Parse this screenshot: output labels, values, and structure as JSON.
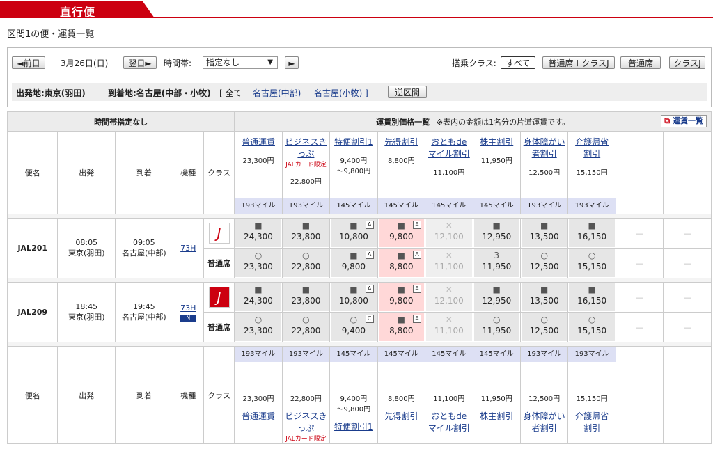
{
  "tab_title": "直行便",
  "route_title": "区間1の便・運賃一覧",
  "nav": {
    "prev": "◄前日",
    "date": "3月26日(日)",
    "next": "翌日►",
    "time_label": "時間帯:",
    "time_value": "指定なし",
    "time_arrow": "▼",
    "go": "►"
  },
  "class_filter": {
    "label": "搭乗クラス:",
    "buttons": [
      "すべて",
      "普通席＋クラスJ",
      "普通席",
      "クラスJ"
    ]
  },
  "route": {
    "dep": "出発地:東京(羽田)",
    "arr_label": "到着地:名古屋(中部・小牧)",
    "all": "[ 全て",
    "opt1": "名古屋(中部)",
    "opt2": "名古屋(小牧) ]",
    "reverse": "逆区間"
  },
  "table_header": {
    "time": "時間帯指定なし",
    "fare_list": "運賃別価格一覧",
    "fare_note": "※表内の金額は1名分の片道運賃です。",
    "fare_btn": "運賃一覧"
  },
  "cols": {
    "flight": "便名",
    "dep": "出発",
    "arr": "到着",
    "model": "機種",
    "cls": "クラス"
  },
  "fares": [
    {
      "name1": "普通運賃",
      "name2": "",
      "sub": "",
      "price1": "23,300円",
      "price2": "",
      "mile": "193マイル"
    },
    {
      "name1": "ビジネスきっぷ",
      "name2": "",
      "sub": "JALカード限定",
      "price1": "22,800円",
      "price2": "",
      "mile": "193マイル"
    },
    {
      "name1": "特便割引1",
      "name2": "",
      "sub": "",
      "price1": "9,400円",
      "price2": "～9,800円",
      "mile": "145マイル"
    },
    {
      "name1": "先得割引",
      "name2": "",
      "sub": "",
      "price1": "8,800円",
      "price2": "",
      "mile": "145マイル"
    },
    {
      "name1": "おともde",
      "name2": "マイル割引",
      "sub": "",
      "price1": "11,100円",
      "price2": "",
      "mile": "145マイル"
    },
    {
      "name1": "株主割引",
      "name2": "",
      "sub": "",
      "price1": "11,950円",
      "price2": "",
      "mile": "145マイル"
    },
    {
      "name1": "身体障がい",
      "name2": "者割引",
      "sub": "",
      "price1": "12,500円",
      "price2": "",
      "mile": "193マイル"
    },
    {
      "name1": "介護帰省",
      "name2": "割引",
      "sub": "",
      "price1": "15,150円",
      "price2": "",
      "mile": "193マイル"
    }
  ],
  "flights": [
    {
      "no": "JAL201",
      "dep_time": "08:05",
      "dep_ap": "東京(羽田)",
      "arr_time": "09:05",
      "arr_ap": "名古屋(中部)",
      "model": "73H",
      "class_label": "普通席",
      "row1": [
        {
          "p": "24,300",
          "t": ""
        },
        {
          "p": "23,800",
          "t": ""
        },
        {
          "p": "10,800",
          "t": "A"
        },
        {
          "p": "9,800",
          "t": "A"
        },
        {
          "p": "12,100",
          "t": ""
        },
        {
          "p": "12,950",
          "t": ""
        },
        {
          "p": "13,500",
          "t": ""
        },
        {
          "p": "16,150",
          "t": ""
        }
      ],
      "row2": [
        {
          "p": "23,300",
          "t": ""
        },
        {
          "p": "22,800",
          "t": ""
        },
        {
          "p": "9,800",
          "t": "A"
        },
        {
          "p": "8,800",
          "t": "A"
        },
        {
          "p": "11,100",
          "t": ""
        },
        {
          "p": "11,950",
          "t": ""
        },
        {
          "p": "12,500",
          "t": ""
        },
        {
          "p": "15,150",
          "t": ""
        }
      ],
      "row2_stock": "3"
    },
    {
      "no": "JAL209",
      "dep_time": "18:45",
      "dep_ap": "東京(羽田)",
      "arr_time": "19:45",
      "arr_ap": "名古屋(中部)",
      "model": "73H",
      "class_label": "普通席",
      "row1": [
        {
          "p": "24,300",
          "t": ""
        },
        {
          "p": "23,800",
          "t": ""
        },
        {
          "p": "10,800",
          "t": "A"
        },
        {
          "p": "9,800",
          "t": "A"
        },
        {
          "p": "12,100",
          "t": ""
        },
        {
          "p": "12,950",
          "t": ""
        },
        {
          "p": "13,500",
          "t": ""
        },
        {
          "p": "16,150",
          "t": ""
        }
      ],
      "row2": [
        {
          "p": "23,300",
          "t": ""
        },
        {
          "p": "22,800",
          "t": ""
        },
        {
          "p": "9,400",
          "t": "C"
        },
        {
          "p": "8,800",
          "t": "A"
        },
        {
          "p": "11,100",
          "t": ""
        },
        {
          "p": "11,950",
          "t": ""
        },
        {
          "p": "12,500",
          "t": ""
        },
        {
          "p": "15,150",
          "t": ""
        }
      ]
    }
  ],
  "dash": "—",
  "colors": {
    "brand": "#cc0010",
    "link": "#1a3c8c",
    "mile_bg": "#dde0f4",
    "pink": "#ffd8d8"
  }
}
